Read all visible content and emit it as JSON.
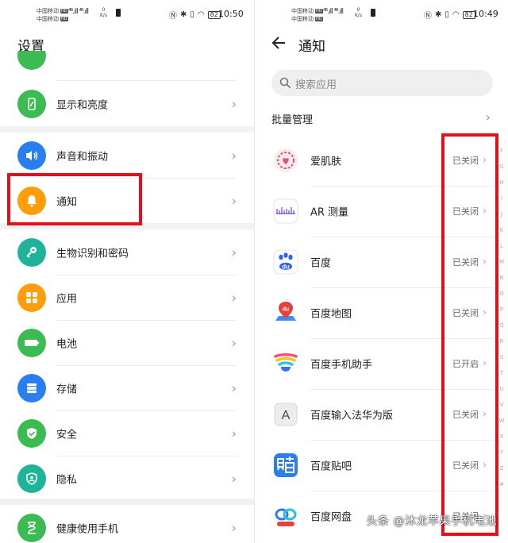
{
  "left": {
    "status": {
      "carrier1": "中国移动",
      "carrier2": "中国移动",
      "hd": "HD",
      "signal": "⁴⁶.ıll ⁴⁶.ıll",
      "speed_value": "0",
      "speed_unit": "K/s",
      "battery": "82",
      "time": "10:50"
    },
    "title": "设置",
    "items": [
      {
        "label": "显示和亮度"
      },
      {
        "label": "声音和振动"
      },
      {
        "label": "通知"
      },
      {
        "label": "生物识别和密码"
      },
      {
        "label": "应用"
      },
      {
        "label": "电池"
      },
      {
        "label": "存储"
      },
      {
        "label": "安全"
      },
      {
        "label": "隐私"
      },
      {
        "label": "健康使用手机"
      }
    ],
    "colors": {
      "green": "#3dbb53",
      "blue": "#2a7ef0",
      "orange": "#ff9d0a",
      "teal": "#1fb39a"
    }
  },
  "right": {
    "status": {
      "carrier1": "中国移动",
      "carrier2": "中国移动",
      "hd": "HD",
      "signal": "⁴⁶.ıll ⁴⁶.ıll",
      "speed_value": "0",
      "speed_unit": "K/s",
      "battery": "82",
      "time": "10:49"
    },
    "title": "通知",
    "search_placeholder": "搜索应用",
    "bulk_label": "批量管理",
    "apps": [
      {
        "name": "爱肌肤",
        "status": "已关闭",
        "icon": "aijifu-icon"
      },
      {
        "name": "AR 测量",
        "status": "已关闭",
        "icon": "ar-measure-icon"
      },
      {
        "name": "百度",
        "status": "已关闭",
        "icon": "baidu-icon"
      },
      {
        "name": "百度地图",
        "status": "已关闭",
        "icon": "baidu-map-icon"
      },
      {
        "name": "百度手机助手",
        "status": "已开启",
        "icon": "baidu-assistant-icon"
      },
      {
        "name": "百度输入法华为版",
        "status": "已关闭",
        "icon": "baidu-input-icon"
      },
      {
        "name": "百度贴吧",
        "status": "已关闭",
        "icon": "baidu-tieba-icon"
      },
      {
        "name": "百度网盘",
        "status": "已关闭",
        "icon": "baidu-netdisk-icon"
      }
    ],
    "alpha_index": [
      "F",
      "G",
      "H",
      "I",
      "J",
      "K",
      "L",
      "M",
      "N",
      "O",
      "P",
      "Q",
      "R",
      "S",
      "T",
      "U",
      "V",
      "W",
      "X",
      "Y",
      "Z",
      "#"
    ]
  },
  "watermark": "头条 @沐龙苹果手机电池",
  "highlight_color": "#e3101a"
}
